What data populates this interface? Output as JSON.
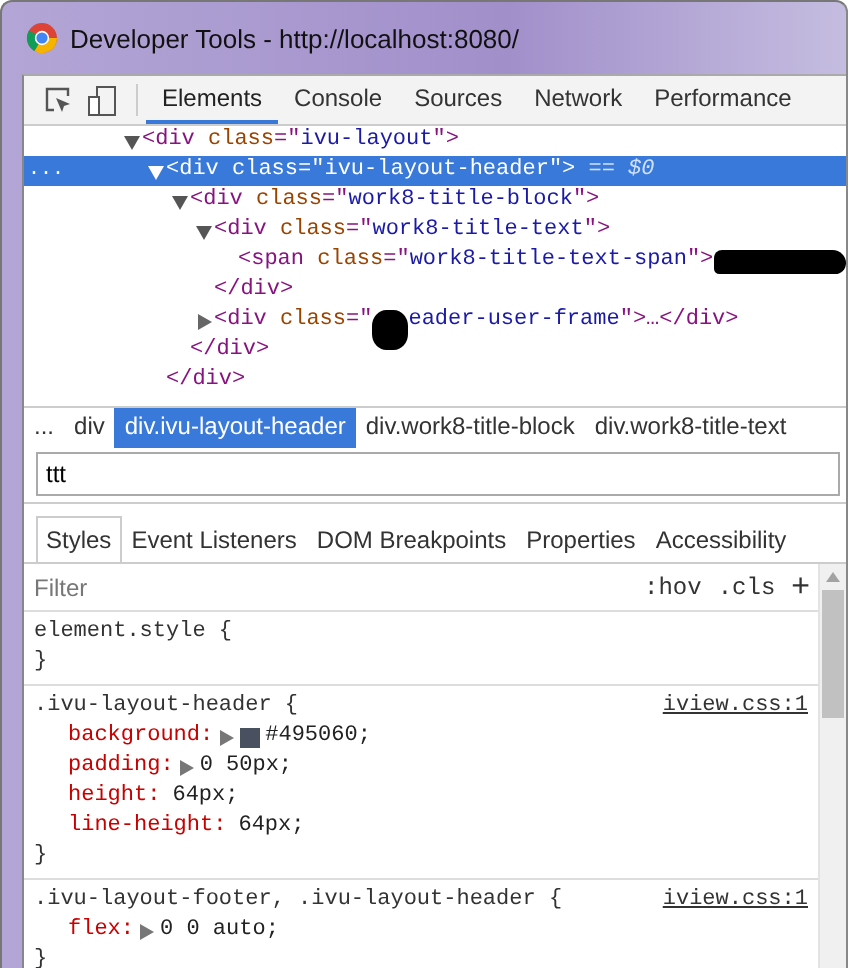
{
  "window": {
    "title": "Developer Tools - http://localhost:8080/"
  },
  "tabs": [
    {
      "label": "Elements",
      "selected": true
    },
    {
      "label": "Console",
      "selected": false
    },
    {
      "label": "Sources",
      "selected": false
    },
    {
      "label": "Network",
      "selected": false
    },
    {
      "label": "Performance",
      "selected": false
    }
  ],
  "dom_tree": [
    {
      "expanded": true,
      "selected": false,
      "parts": [
        {
          "kind": "tag",
          "text": "<div"
        },
        {
          "kind": "attr",
          "text": " class"
        },
        {
          "kind": "punct",
          "text": "=\""
        },
        {
          "kind": "value",
          "text": "ivu-layout"
        },
        {
          "kind": "punct",
          "text": "\">"
        }
      ],
      "children": [
        {
          "depth_marker": "...",
          "expanded": true,
          "selected": true,
          "parts": [
            {
              "kind": "tag",
              "text": "<div"
            },
            {
              "kind": "attr",
              "text": " class"
            },
            {
              "kind": "punct",
              "text": "=\""
            },
            {
              "kind": "value",
              "text": "ivu-layout-header"
            },
            {
              "kind": "punct",
              "text": "\">"
            },
            {
              "kind": "ref",
              "text": " == $0"
            }
          ],
          "children": [
            {
              "expanded": true,
              "selected": false,
              "parts": [
                {
                  "kind": "tag",
                  "text": "<div"
                },
                {
                  "kind": "attr",
                  "text": " class"
                },
                {
                  "kind": "punct",
                  "text": "=\""
                },
                {
                  "kind": "value",
                  "text": "work8-title-block"
                },
                {
                  "kind": "punct",
                  "text": "\">"
                }
              ],
              "children": [
                {
                  "expanded": true,
                  "selected": false,
                  "parts": [
                    {
                      "kind": "tag",
                      "text": "<div"
                    },
                    {
                      "kind": "attr",
                      "text": " class"
                    },
                    {
                      "kind": "punct",
                      "text": "=\""
                    },
                    {
                      "kind": "value",
                      "text": "work8-title-text"
                    },
                    {
                      "kind": "punct",
                      "text": "\">"
                    }
                  ],
                  "children": [
                    {
                      "selected": false,
                      "parts": [
                        {
                          "kind": "tag",
                          "text": "<span"
                        },
                        {
                          "kind": "attr",
                          "text": " class"
                        },
                        {
                          "kind": "punct",
                          "text": "=\""
                        },
                        {
                          "kind": "value",
                          "text": "work8-title-text-span"
                        },
                        {
                          "kind": "punct",
                          "text": "\">"
                        },
                        {
                          "kind": "redaction"
                        }
                      ]
                    }
                  ]
                },
                {
                  "selected": false,
                  "parts": [
                    {
                      "kind": "tag",
                      "text": "</div>"
                    }
                  ]
                },
                {
                  "expanded": false,
                  "selected": false,
                  "parts": [
                    {
                      "kind": "tag",
                      "text": "<div"
                    },
                    {
                      "kind": "attr",
                      "text": " class"
                    },
                    {
                      "kind": "punct",
                      "text": "=\""
                    },
                    {
                      "kind": "redaction"
                    },
                    {
                      "kind": "value",
                      "text": "eader-user-frame"
                    },
                    {
                      "kind": "punct",
                      "text": "\">…"
                    },
                    {
                      "kind": "tag",
                      "text": "</div>"
                    }
                  ]
                }
              ]
            },
            {
              "selected": false,
              "parts": [
                {
                  "kind": "tag",
                  "text": "</div>"
                }
              ]
            }
          ]
        },
        {
          "selected": false,
          "parts": [
            {
              "kind": "tag",
              "text": "</div>"
            }
          ]
        }
      ]
    }
  ],
  "breadcrumbs": [
    {
      "label": "...",
      "selected": false
    },
    {
      "label": "div",
      "selected": false
    },
    {
      "label": "div.ivu-layout-header",
      "selected": true
    },
    {
      "label": "div.work8-title-block",
      "selected": false
    },
    {
      "label": "div.work8-title-text",
      "selected": false
    }
  ],
  "search": {
    "value": "ttt"
  },
  "sidebar_tabs": [
    {
      "label": "Styles",
      "selected": true
    },
    {
      "label": "Event Listeners",
      "selected": false
    },
    {
      "label": "DOM Breakpoints",
      "selected": false
    },
    {
      "label": "Properties",
      "selected": false
    },
    {
      "label": "Accessibility",
      "selected": false
    }
  ],
  "filter": {
    "placeholder": "Filter",
    "hov": ":hov",
    "cls": ".cls",
    "add": "+"
  },
  "rules": [
    {
      "selector": "element.style {",
      "close": "}"
    },
    {
      "selector": ".ivu-layout-header {",
      "source": "iview.css:1",
      "close": "}",
      "properties": [
        {
          "name": "background:",
          "expandable": true,
          "color": "#495060",
          "value": "#495060;"
        },
        {
          "name": "padding:",
          "expandable": true,
          "value": "0 50px;"
        },
        {
          "name": "height:",
          "expandable": false,
          "value": "64px;"
        },
        {
          "name": "line-height:",
          "expandable": false,
          "value": "64px;"
        }
      ]
    },
    {
      "selector": ".ivu-layout-footer, .ivu-layout-header {",
      "source": "iview.css:1",
      "close": "}",
      "properties": [
        {
          "name": "flex:",
          "expandable": true,
          "value": "0 0 auto;"
        }
      ]
    }
  ]
}
